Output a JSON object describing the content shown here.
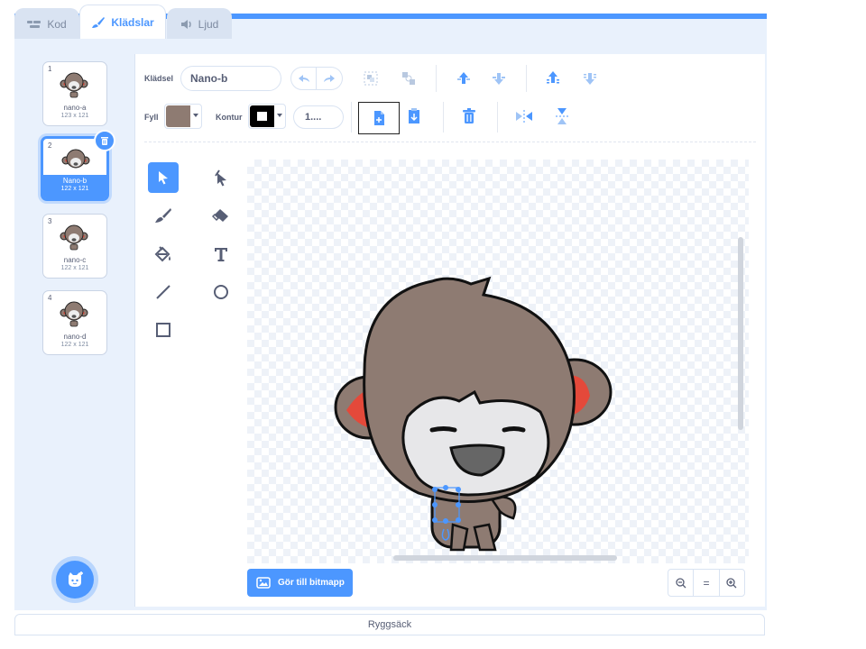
{
  "tabs": [
    {
      "label": "Kod"
    },
    {
      "label": "Klädslar"
    },
    {
      "label": "Ljud"
    }
  ],
  "costumes": [
    {
      "num": "1",
      "name": "nano-a",
      "size": "123 x 121"
    },
    {
      "num": "2",
      "name": "Nano-b",
      "size": "122 x 121"
    },
    {
      "num": "3",
      "name": "nano-c",
      "size": "122 x 121"
    },
    {
      "num": "4",
      "name": "nano-d",
      "size": "122 x 121"
    }
  ],
  "toolbar": {
    "costume_label": "Klädsel",
    "costume_name": "Nano-b",
    "fill_label": "Fyll",
    "outline_label": "Kontur",
    "outline_size": "1....",
    "fill_color": "#8e7b72",
    "outline_color": "#000000"
  },
  "canvas": {
    "convert_label": "Gör till bitmapp"
  },
  "zoom": {
    "reset_label": "="
  },
  "backpack_label": "Ryggsäck",
  "colors": {
    "accent": "#4c97ff",
    "fur": "#8e7b72",
    "ear_inner": "#e4493a"
  },
  "icons": [
    "code-icon",
    "brush-icon",
    "sound-icon",
    "undo-icon",
    "redo-icon",
    "group-icon",
    "ungroup-icon",
    "forward-icon",
    "backward-icon",
    "front-icon",
    "back-icon",
    "copy-icon",
    "paste-icon",
    "trash-icon",
    "flip-horizontal-icon",
    "flip-vertical-icon",
    "select-icon",
    "reshape-icon",
    "brush-tool-icon",
    "eraser-icon",
    "fill-icon",
    "text-icon",
    "line-icon",
    "circle-icon",
    "rectangle-icon",
    "zoom-out-icon",
    "zoom-in-icon",
    "image-icon",
    "cat-add-icon"
  ]
}
